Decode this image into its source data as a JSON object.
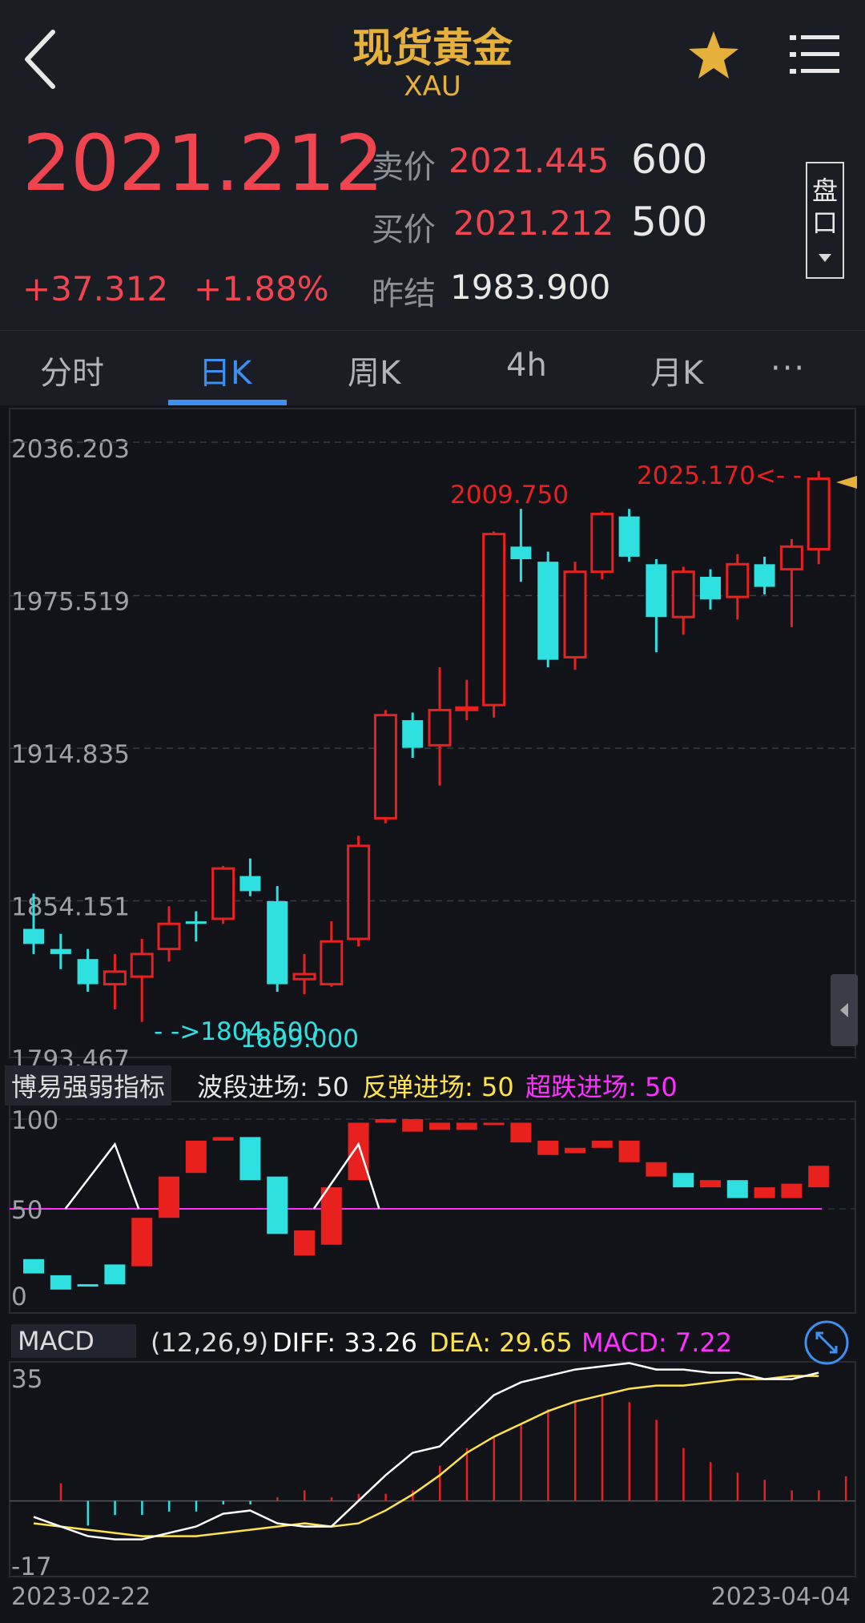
{
  "header": {
    "title": "现货黄金",
    "symbol": "XAU",
    "back_icon": "chevron-left-icon",
    "favorite_icon": "star-icon",
    "menu_icon": "hamburger-menu-icon"
  },
  "quote": {
    "last": "2021.212",
    "change": "+37.312",
    "change_pct": "+1.88%",
    "ask_label": "卖价",
    "ask": "2021.445",
    "ask_qty": "600",
    "bid_label": "买价",
    "bid": "2021.212",
    "bid_qty": "500",
    "prev_close_label": "昨结",
    "prev_close": "1983.900",
    "pankou_label_1": "盘",
    "pankou_label_2": "口"
  },
  "tabs": [
    {
      "label": "分时"
    },
    {
      "label": "日K",
      "active": true
    },
    {
      "label": "周K"
    },
    {
      "label": "4h"
    },
    {
      "label": "月K"
    }
  ],
  "more_label": "···",
  "colors": {
    "up": "#e8211f",
    "down": "#2fe0e0",
    "accent": "#3d8ff0",
    "gold": "#e6b13a",
    "magenta": "#ff2fff",
    "yellow": "#ffe34a"
  },
  "chart_data": [
    {
      "type": "candlestick",
      "title": "日K",
      "y_ticks": [
        "2036.203",
        "1975.519",
        "1914.835",
        "1854.151",
        "1793.467"
      ],
      "ylim": [
        1793.467,
        2036.203
      ],
      "max_label": "2009.750",
      "last_high_label": "2025.170<- -",
      "low_label": "- ->1804.500",
      "low2_label": "1809.000",
      "candles": [
        {
          "o": 1843,
          "c": 1837,
          "h": 1857,
          "l": 1833
        },
        {
          "o": 1835,
          "c": 1833,
          "h": 1841,
          "l": 1827
        },
        {
          "o": 1831,
          "c": 1821,
          "h": 1835,
          "l": 1818
        },
        {
          "o": 1821,
          "c": 1826,
          "h": 1833,
          "l": 1811
        },
        {
          "o": 1824,
          "c": 1833,
          "h": 1839,
          "l": 1806
        },
        {
          "o": 1835,
          "c": 1845,
          "h": 1852,
          "l": 1830
        },
        {
          "o": 1846,
          "c": 1845,
          "h": 1850,
          "l": 1838
        },
        {
          "o": 1847,
          "c": 1867,
          "h": 1868,
          "l": 1845
        },
        {
          "o": 1864,
          "c": 1858,
          "h": 1871,
          "l": 1856
        },
        {
          "o": 1854,
          "c": 1821,
          "h": 1860,
          "l": 1818
        },
        {
          "o": 1823,
          "c": 1825,
          "h": 1833,
          "l": 1817
        },
        {
          "o": 1821,
          "c": 1838,
          "h": 1846,
          "l": 1820
        },
        {
          "o": 1839,
          "c": 1876,
          "h": 1880,
          "l": 1836
        },
        {
          "o": 1887,
          "c": 1928,
          "h": 1930,
          "l": 1885
        },
        {
          "o": 1926,
          "c": 1915,
          "h": 1929,
          "l": 1911
        },
        {
          "o": 1916,
          "c": 1930,
          "h": 1947,
          "l": 1900
        },
        {
          "o": 1931,
          "c": 1931,
          "h": 1942,
          "l": 1926
        },
        {
          "o": 1932,
          "c": 2000,
          "h": 2001,
          "l": 1927
        },
        {
          "o": 1995,
          "c": 1990,
          "h": 2010,
          "l": 1981
        },
        {
          "o": 1989,
          "c": 1950,
          "h": 1993,
          "l": 1947
        },
        {
          "o": 1951,
          "c": 1985,
          "h": 1989,
          "l": 1946
        },
        {
          "o": 1985,
          "c": 2008,
          "h": 2009,
          "l": 1982
        },
        {
          "o": 2007,
          "c": 1991,
          "h": 2010,
          "l": 1989
        },
        {
          "o": 1988,
          "c": 1967,
          "h": 1990,
          "l": 1953
        },
        {
          "o": 1967,
          "c": 1985,
          "h": 1987,
          "l": 1960
        },
        {
          "o": 1983,
          "c": 1974,
          "h": 1986,
          "l": 1970
        },
        {
          "o": 1975,
          "c": 1988,
          "h": 1992,
          "l": 1966
        },
        {
          "o": 1988,
          "c": 1979,
          "h": 1991,
          "l": 1976
        },
        {
          "o": 1986,
          "c": 1995,
          "h": 1998,
          "l": 1963
        },
        {
          "o": 1994,
          "c": 2022,
          "h": 2025,
          "l": 1988
        }
      ]
    },
    {
      "type": "bar",
      "title": "博易强弱指标",
      "ylim": [
        0,
        100
      ],
      "y_ticks": [
        "100",
        "50",
        "0"
      ],
      "values": [
        {
          "o": 14,
          "c": 22
        },
        {
          "o": 5,
          "c": 13
        },
        {
          "o": 8,
          "c": 8
        },
        {
          "o": 8,
          "c": 19
        },
        {
          "o": 18,
          "c": 45
        },
        {
          "o": 45,
          "c": 68
        },
        {
          "o": 70,
          "c": 88
        },
        {
          "o": 88,
          "c": 90
        },
        {
          "o": 90,
          "c": 66
        },
        {
          "o": 68,
          "c": 36
        },
        {
          "o": 24,
          "c": 38
        },
        {
          "o": 30,
          "c": 62
        },
        {
          "o": 66,
          "c": 98
        },
        {
          "o": 98,
          "c": 100
        },
        {
          "o": 93,
          "c": 100
        },
        {
          "o": 94,
          "c": 98
        },
        {
          "o": 94,
          "c": 98
        },
        {
          "o": 97,
          "c": 98
        },
        {
          "o": 87,
          "c": 98
        },
        {
          "o": 80,
          "c": 88
        },
        {
          "o": 81,
          "c": 84
        },
        {
          "o": 84,
          "c": 88
        },
        {
          "o": 76,
          "c": 88
        },
        {
          "o": 68,
          "c": 76
        },
        {
          "o": 62,
          "c": 70
        },
        {
          "o": 62,
          "c": 66
        },
        {
          "o": 56,
          "c": 66
        },
        {
          "o": 56,
          "c": 62
        },
        {
          "o": 56,
          "c": 64
        },
        {
          "o": 62,
          "c": 74
        }
      ]
    },
    {
      "type": "bar",
      "title": "MACD",
      "y_ticks": [
        "35",
        "-17"
      ],
      "ylim": [
        -17,
        35
      ],
      "diff": [
        -5,
        -8,
        -11,
        -12,
        -12,
        -10,
        -8,
        -4,
        -3,
        -7,
        -8,
        -8,
        0,
        8,
        15,
        17,
        25,
        33,
        37,
        39,
        41,
        42,
        43,
        41,
        41,
        40,
        40,
        38,
        38,
        40
      ],
      "dea": [
        -7,
        -8,
        -9,
        -10,
        -11,
        -11,
        -11,
        -10,
        -9,
        -8,
        -7,
        -8,
        -7,
        -3,
        2,
        8,
        15,
        20,
        24,
        28,
        31,
        33,
        35,
        36,
        36,
        37,
        38,
        38,
        39,
        39
      ],
      "macd": [
        5,
        -7,
        -4,
        -4,
        -3,
        -3,
        -1,
        -1,
        1,
        3,
        1,
        2,
        2,
        3,
        10,
        15,
        18,
        22,
        26,
        28,
        30,
        28,
        23,
        15,
        11,
        8,
        6,
        3,
        3,
        7
      ]
    }
  ],
  "indicator": {
    "tag": "博易强弱指标",
    "params": [
      {
        "label": "波段进场: 50"
      },
      {
        "label": "反弹进场: 50"
      },
      {
        "label": "超跌进场: 50"
      }
    ]
  },
  "macd": {
    "tag": "MACD",
    "params": "(12,26,9)",
    "diff": "DIFF: 33.26",
    "dea": "DEA: 29.65",
    "macd": "MACD: 7.22"
  },
  "dates": {
    "start": "2023-02-22",
    "end": "2023-04-04"
  }
}
